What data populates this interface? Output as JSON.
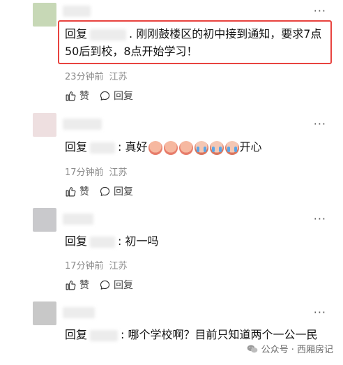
{
  "comments": [
    {
      "avatar_color": "#c7d8b6",
      "reply_prefix": "回复",
      "text": ". 刚刚鼓楼区的初中接到通知，要求7点50后到校，8点开始学习！",
      "time": "23分钟前",
      "location": "江苏",
      "like_label": "赞",
      "reply_label": "回复"
    },
    {
      "avatar_color": "#eedfe0",
      "reply_prefix": "回复",
      "text_before": ": 真好",
      "text_after": "开心",
      "emoji_count": 6,
      "time": "17分钟前",
      "location": "江苏",
      "like_label": "赞",
      "reply_label": "回复"
    },
    {
      "avatar_color": "#c9c9cc",
      "reply_prefix": "回复",
      "text": ": 初一吗",
      "time": "17分钟前",
      "location": "江苏",
      "like_label": "赞",
      "reply_label": "回复"
    },
    {
      "avatar_color": "#c8c8c8",
      "reply_prefix": "回复",
      "text": ": 哪个学校啊？目前只知道两个一公一民"
    }
  ],
  "more_label": "···",
  "watermark": "公众号 · 西厢房记",
  "icons": {
    "like": "thumb-up-icon",
    "reply": "speech-bubble-icon",
    "more": "more-dots-icon",
    "watermark": "wechat-icon"
  },
  "highlight_color": "#e8433f"
}
